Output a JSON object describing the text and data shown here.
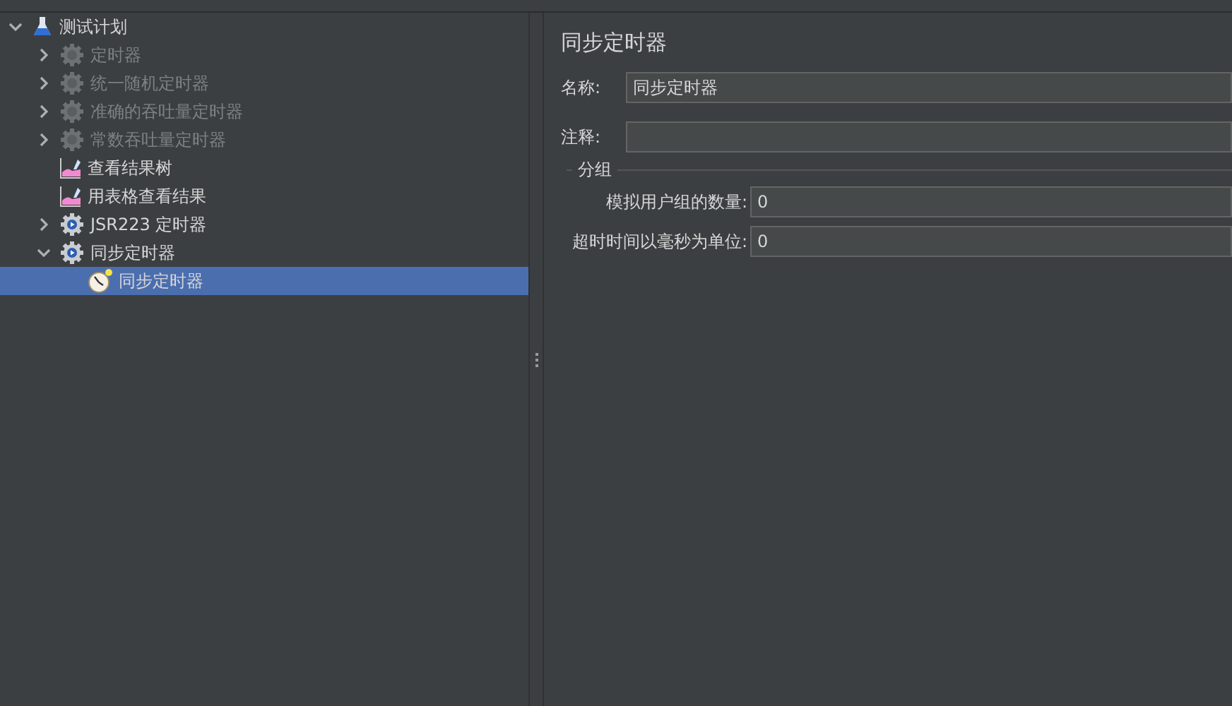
{
  "tree": [
    {
      "label": "测试计划",
      "kind": "plan",
      "expanded": true,
      "disabled": false,
      "selected": false,
      "children": [
        {
          "label": "定时器",
          "kind": "gear",
          "expanded": false,
          "disabled": true,
          "selected": false
        },
        {
          "label": "统一随机定时器",
          "kind": "gear",
          "expanded": false,
          "disabled": true,
          "selected": false
        },
        {
          "label": "准确的吞吐量定时器",
          "kind": "gear",
          "expanded": false,
          "disabled": true,
          "selected": false
        },
        {
          "label": "常数吞吐量定时器",
          "kind": "gear",
          "expanded": false,
          "disabled": true,
          "selected": false
        },
        {
          "label": "查看结果树",
          "kind": "listener",
          "disabled": false,
          "selected": false
        },
        {
          "label": "用表格查看结果",
          "kind": "listener",
          "disabled": false,
          "selected": false
        },
        {
          "label": "JSR223 定时器",
          "kind": "gear",
          "expanded": false,
          "disabled": false,
          "selected": false
        },
        {
          "label": "同步定时器",
          "kind": "gear",
          "expanded": true,
          "disabled": false,
          "selected": false,
          "children": [
            {
              "label": "同步定时器",
              "kind": "timer",
              "disabled": false,
              "selected": true
            }
          ]
        }
      ]
    }
  ],
  "panel": {
    "title": "同步定时器",
    "name": {
      "label": "名称:",
      "value": "同步定时器"
    },
    "comment": {
      "label": "注释:"
    },
    "group": {
      "label": "分组",
      "fields": [
        {
          "label": "模拟用户组的数量:",
          "value": "0"
        },
        {
          "label": "超时时间以毫秒为单位:",
          "value": "0"
        }
      ]
    }
  }
}
